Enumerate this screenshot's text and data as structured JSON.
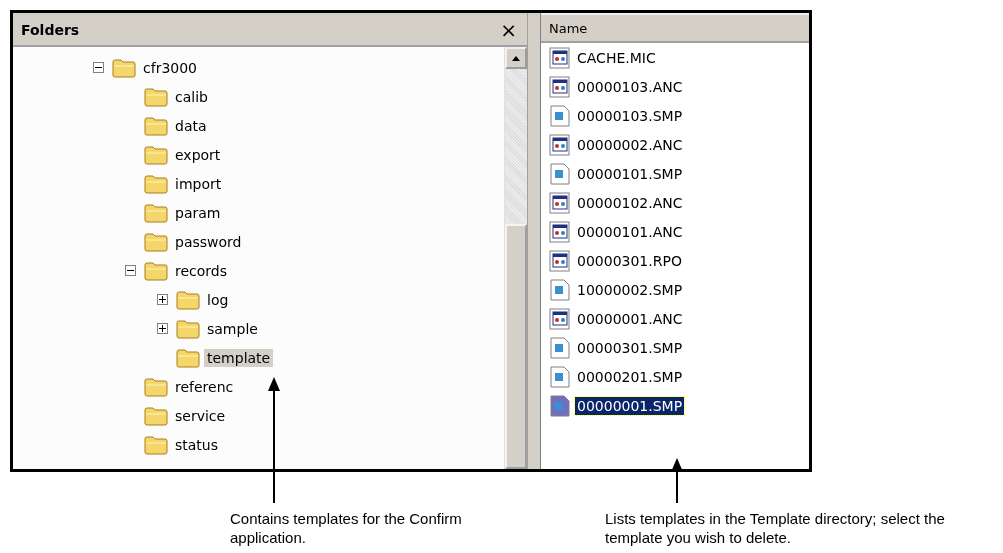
{
  "folders_pane": {
    "title": "Folders",
    "close": "×",
    "tree": [
      {
        "label": "cfr3000",
        "expanded": true,
        "selected": false,
        "children": [
          {
            "label": "calib",
            "selected": false
          },
          {
            "label": "data",
            "selected": false
          },
          {
            "label": "export",
            "selected": false
          },
          {
            "label": "import",
            "selected": false
          },
          {
            "label": "param",
            "selected": false
          },
          {
            "label": "password",
            "selected": false
          },
          {
            "label": "records",
            "expanded": true,
            "selected": false,
            "children": [
              {
                "label": "log",
                "expanded": false,
                "selected": false
              },
              {
                "label": "sample",
                "expanded": false,
                "selected": false
              },
              {
                "label": "template",
                "selected": true
              }
            ]
          },
          {
            "label": "referenc",
            "selected": false
          },
          {
            "label": "service",
            "selected": false
          },
          {
            "label": "status",
            "selected": false
          }
        ]
      }
    ]
  },
  "files_pane": {
    "column": "Name",
    "files": [
      {
        "name": "CACHE.MIC",
        "kind": "app",
        "selected": false
      },
      {
        "name": "00000103.ANC",
        "kind": "app",
        "selected": false
      },
      {
        "name": "00000103.SMP",
        "kind": "doc",
        "selected": false
      },
      {
        "name": "00000002.ANC",
        "kind": "app",
        "selected": false
      },
      {
        "name": "00000101.SMP",
        "kind": "doc",
        "selected": false
      },
      {
        "name": "00000102.ANC",
        "kind": "app",
        "selected": false
      },
      {
        "name": "00000101.ANC",
        "kind": "app",
        "selected": false
      },
      {
        "name": "00000301.RPO",
        "kind": "app",
        "selected": false
      },
      {
        "name": "10000002.SMP",
        "kind": "doc",
        "selected": false
      },
      {
        "name": "00000001.ANC",
        "kind": "app",
        "selected": false
      },
      {
        "name": "00000301.SMP",
        "kind": "doc",
        "selected": false
      },
      {
        "name": "00000201.SMP",
        "kind": "doc",
        "selected": false
      },
      {
        "name": "00000001.SMP",
        "kind": "doc",
        "selected": true
      }
    ]
  },
  "callouts": [
    {
      "text": "Contains templates for the Confirm application."
    },
    {
      "text": "Lists templates in the Template directory; select the template you wish to delete."
    }
  ]
}
